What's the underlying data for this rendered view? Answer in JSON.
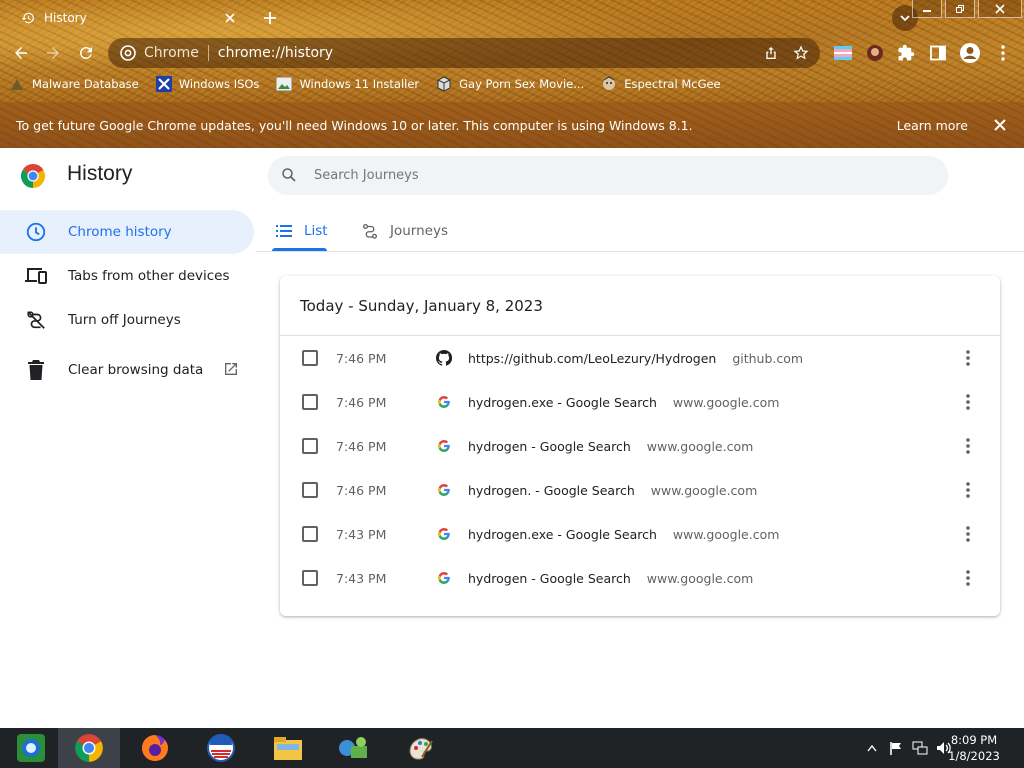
{
  "tab": {
    "title": "History"
  },
  "omnibox": {
    "site": "Chrome",
    "url": "chrome://history"
  },
  "bookmarks": [
    {
      "label": "Malware Database"
    },
    {
      "label": "Windows ISOs"
    },
    {
      "label": "Windows 11 Installer"
    },
    {
      "label": "Gay Porn Sex Movie..."
    },
    {
      "label": "Espectral McGee"
    }
  ],
  "infobar": {
    "message": "To get future Google Chrome updates, you'll need Windows 10 or later. This computer is using Windows 8.1.",
    "learn_more": "Learn more"
  },
  "history": {
    "title": "History",
    "search_placeholder": "Search Journeys",
    "sidebar": [
      {
        "label": "Chrome history"
      },
      {
        "label": "Tabs from other devices"
      },
      {
        "label": "Turn off Journeys"
      },
      {
        "label": "Clear browsing data"
      }
    ],
    "tabs": [
      {
        "label": "List"
      },
      {
        "label": "Journeys"
      }
    ],
    "day_header": "Today - Sunday, January 8, 2023",
    "entries": [
      {
        "time": "7:46 PM",
        "title": "https://github.com/LeoLezury/Hydrogen",
        "domain": "github.com",
        "icon": "github-icon"
      },
      {
        "time": "7:46 PM",
        "title": "hydrogen.exe - Google Search",
        "domain": "www.google.com",
        "icon": "google-icon"
      },
      {
        "time": "7:46 PM",
        "title": "hydrogen - Google Search",
        "domain": "www.google.com",
        "icon": "google-icon"
      },
      {
        "time": "7:46 PM",
        "title": "hydrogen. - Google Search",
        "domain": "www.google.com",
        "icon": "google-icon"
      },
      {
        "time": "7:43 PM",
        "title": "hydrogen.exe - Google Search",
        "domain": "www.google.com",
        "icon": "google-icon"
      },
      {
        "time": "7:43 PM",
        "title": "hydrogen - Google Search",
        "domain": "www.google.com",
        "icon": "google-icon"
      }
    ]
  },
  "clock": {
    "time": "8:09 PM",
    "date": "1/8/2023"
  },
  "colors": {
    "accent": "#1a73e8",
    "chrome_theme": "#b8761c",
    "infobar": "#98581a",
    "taskbar": "#1f2326"
  }
}
